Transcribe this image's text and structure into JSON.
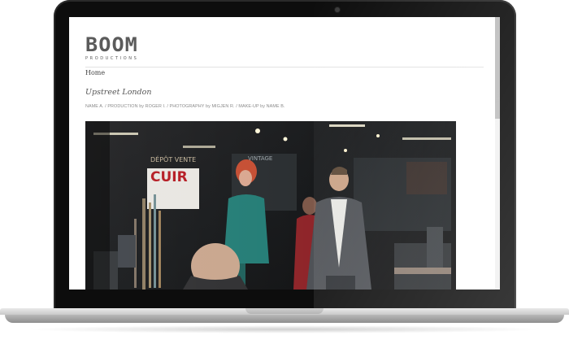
{
  "site": {
    "logo_word": "BOOM",
    "logo_sub": "PRODUCTIONS",
    "nav_home": "Home"
  },
  "post": {
    "title": "Upstreet London",
    "credits": "NAME A. / PRODUCTION by ROGER I. / PHOTOGRAPHY by MIGJEN R. / MAKE-UP by NAME B.",
    "photo": {
      "sign_line1": "DÉPÔT VENTE",
      "sign_line2": "CUIR",
      "sign_right": "VINTAGE"
    }
  },
  "colors": {
    "laptop_bezel": "#0d0d0d",
    "aluminium": "#c9c9c9",
    "logo_grey": "#5b5b5b",
    "sign_red": "#b3141c"
  }
}
